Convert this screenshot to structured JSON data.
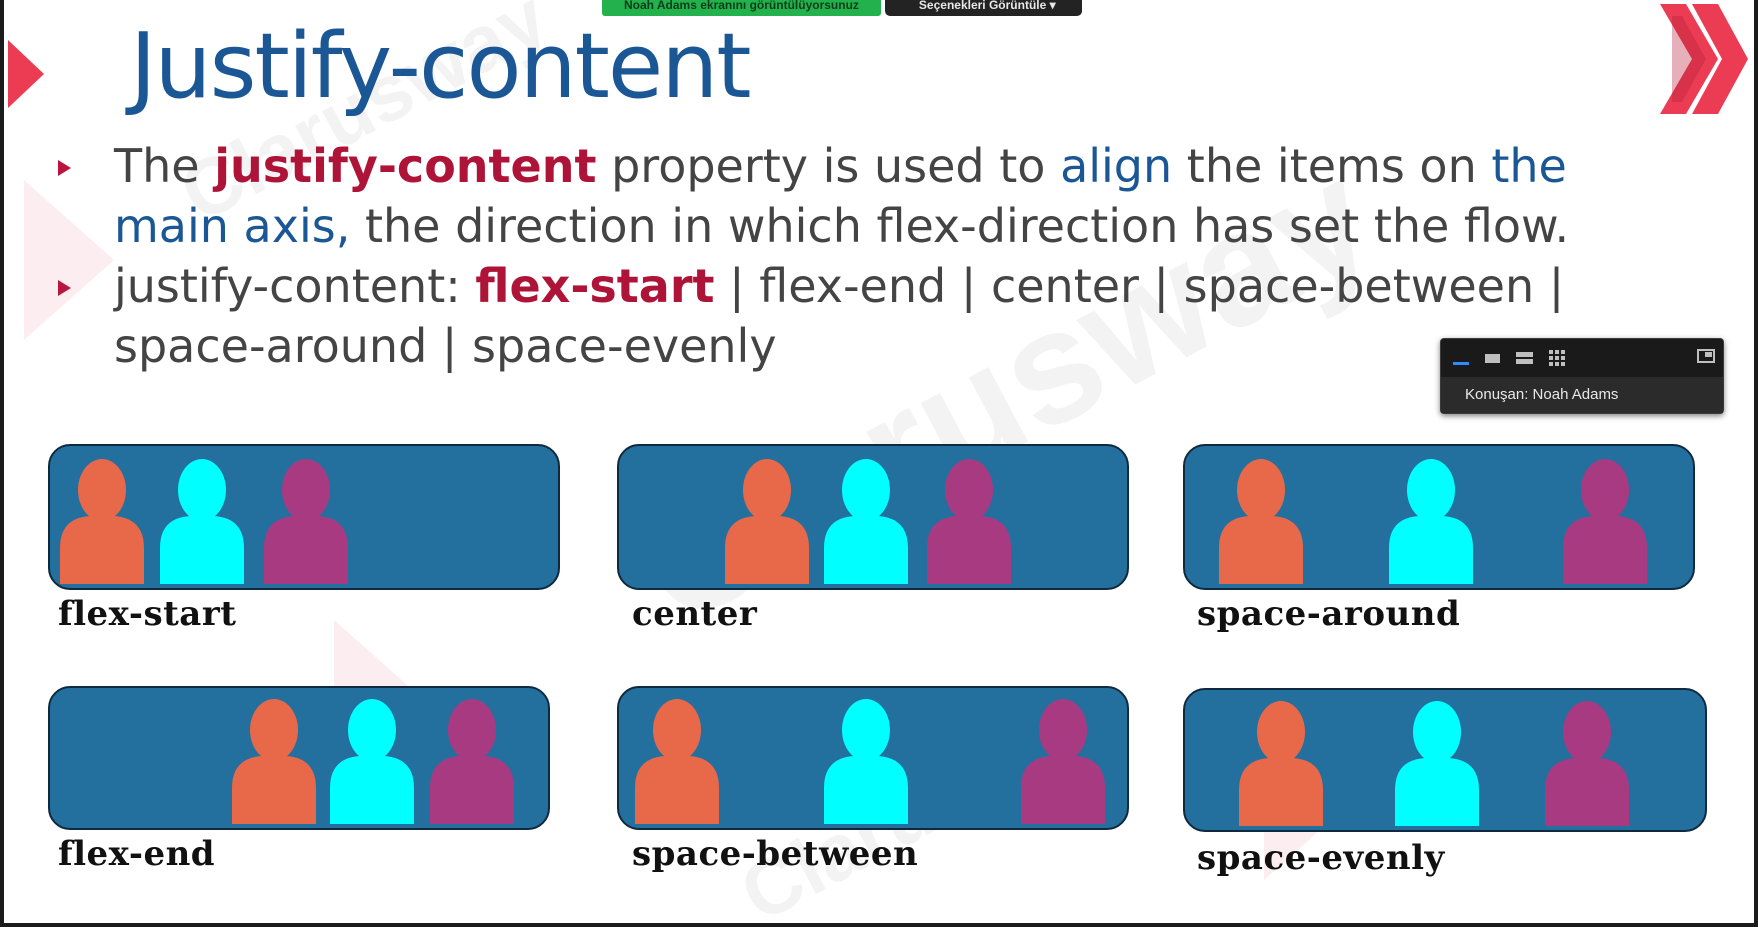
{
  "screen_share": {
    "banner_text": "Noah Adams ekranını görüntülüyorsunuz",
    "options_label": "Seçenekleri Görüntüle ▾"
  },
  "slide": {
    "title": "Justify-content",
    "bullet1": {
      "part1": "The ",
      "part2": "justify-content",
      "part3": " property is used to ",
      "part4": "align",
      "part5": " the items on ",
      "part6": "the main axis,",
      "part7": " the direction in which flex-direction has set the flow."
    },
    "bullet2": {
      "part1": "justify-content: ",
      "part2": "flex-start",
      "part3": " | flex-end | center | space-between | space-around | space-evenly"
    },
    "watermark": "Clarusway"
  },
  "speaker_panel": {
    "label": "Konuşan: Noah Adams"
  },
  "panels": [
    {
      "label": "flex-start"
    },
    {
      "label": "center"
    },
    {
      "label": "space-around"
    },
    {
      "label": "flex-end"
    },
    {
      "label": "space-between"
    },
    {
      "label": "space-evenly"
    }
  ],
  "colors": {
    "title_blue": "#1c5795",
    "accent_red": "#ad1438",
    "panel_blue": "#23709f",
    "person_orange": "#e8684a",
    "person_cyan": "#00ffff",
    "person_purple": "#a83a82"
  },
  "icons": [
    "minimize-icon",
    "speaker-view-icon",
    "split-view-icon",
    "gallery-view-icon",
    "expand-icon",
    "clarusway-chevron-logo-icon"
  ]
}
